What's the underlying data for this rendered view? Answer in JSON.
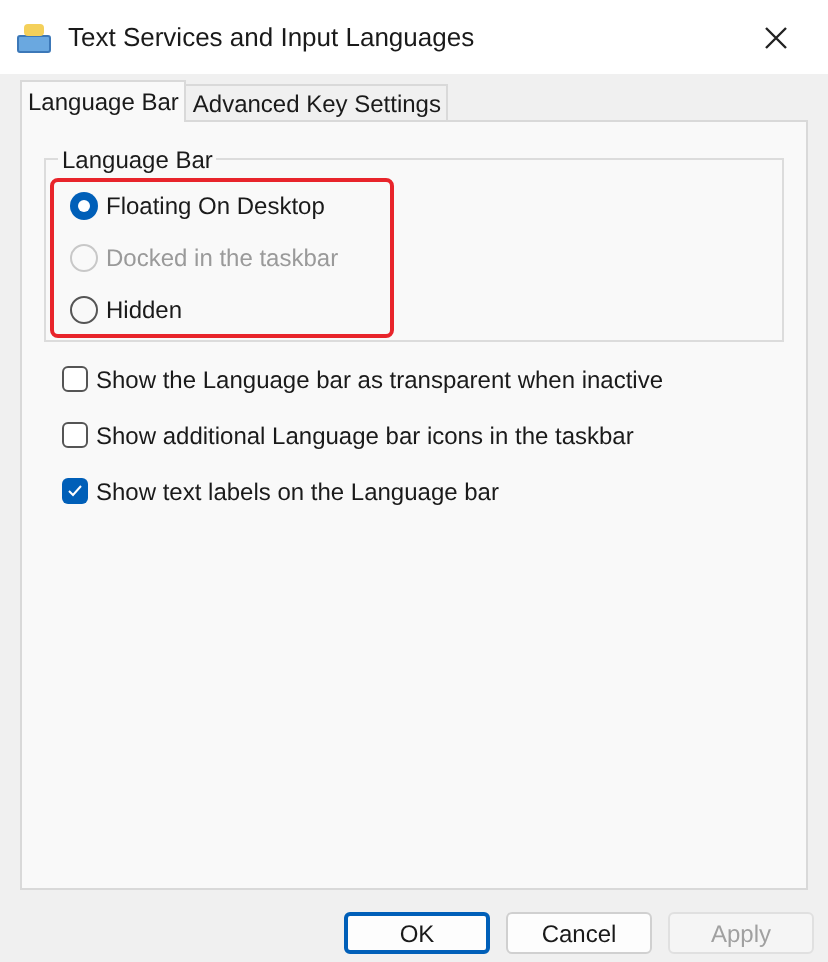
{
  "window": {
    "title": "Text Services and Input Languages"
  },
  "tabs": [
    {
      "label": "Language Bar",
      "selected": true
    },
    {
      "label": "Advanced Key Settings",
      "selected": false
    }
  ],
  "group": {
    "title": "Language Bar",
    "highlighted": true,
    "options": [
      {
        "label": "Floating On Desktop",
        "selected": true,
        "disabled": false
      },
      {
        "label": "Docked in the taskbar",
        "selected": false,
        "disabled": true
      },
      {
        "label": "Hidden",
        "selected": false,
        "disabled": false
      }
    ]
  },
  "checkboxes": [
    {
      "label": "Show the Language bar as transparent when inactive",
      "checked": false
    },
    {
      "label": "Show additional Language bar icons in the taskbar",
      "checked": false
    },
    {
      "label": "Show text labels on the Language bar",
      "checked": true
    }
  ],
  "buttons": [
    {
      "label": "OK",
      "default": true,
      "disabled": false
    },
    {
      "label": "Cancel",
      "default": false,
      "disabled": false
    },
    {
      "label": "Apply",
      "default": false,
      "disabled": true
    }
  ]
}
